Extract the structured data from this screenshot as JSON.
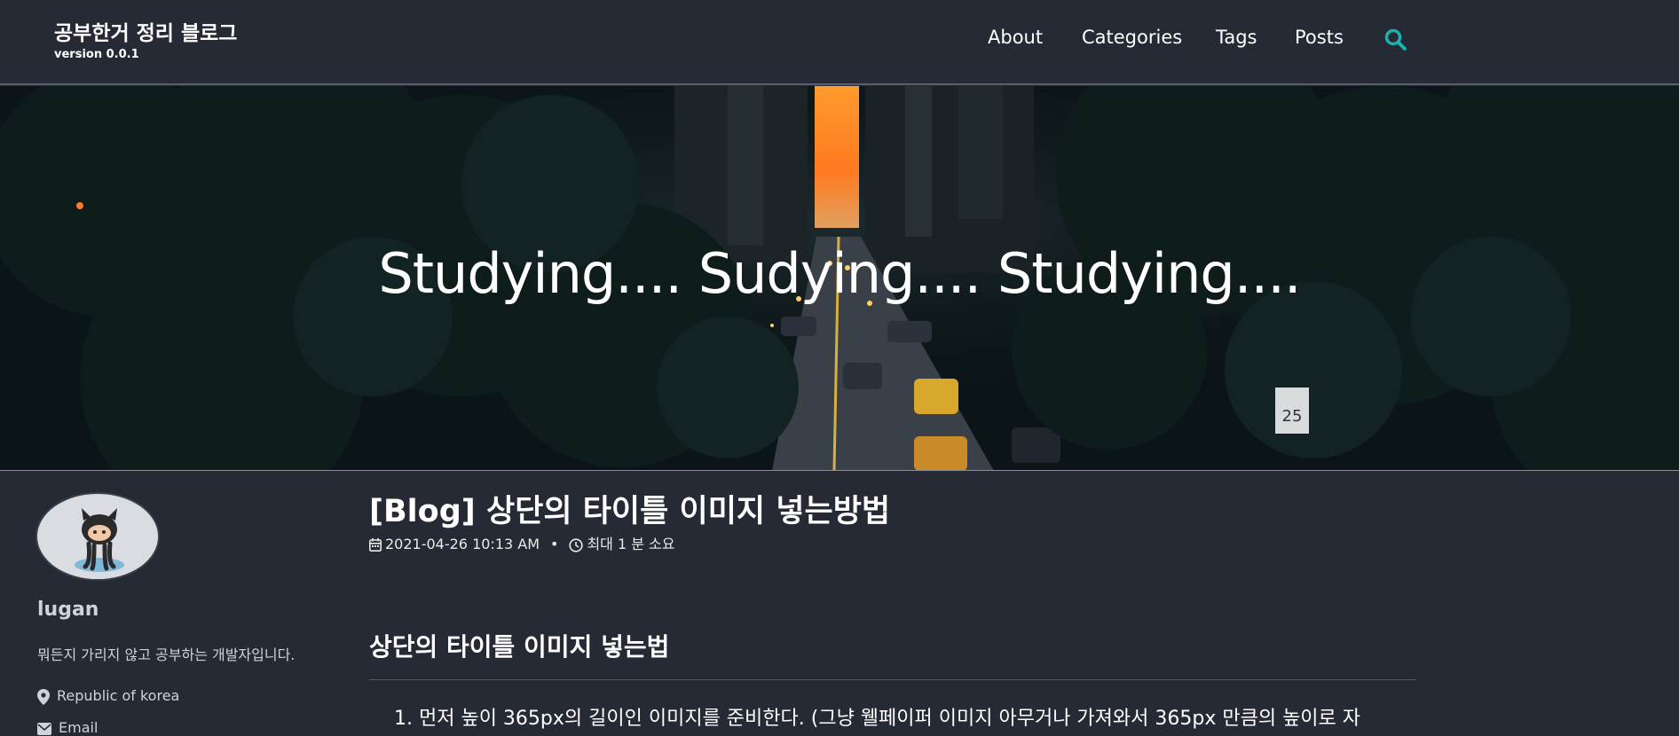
{
  "masthead": {
    "title": "공부한거 정리 블로그",
    "subtitle": "version 0.0.1",
    "nav": [
      {
        "label": "About"
      },
      {
        "label": "Categories"
      },
      {
        "label": "Tags"
      },
      {
        "label": "Posts"
      }
    ],
    "search_icon": "search-icon",
    "accent_color": "#1fb1b1"
  },
  "hero": {
    "title": "Studying.... Sudying.... Studying...."
  },
  "author": {
    "name": "lugan",
    "bio": "뭐든지 가리지 않고 공부하는 개발자입니다.",
    "location": "Republic of korea",
    "email_label": "Email"
  },
  "post": {
    "title": "[Blog] 상단의 타이틀 이미지 넣는방법",
    "date": "2021-04-26 10:13 AM",
    "read_time": "최대 1 분 소요",
    "section_heading": "상단의 타이틀 이미지 넣는법",
    "list": [
      "먼저 높이 365px의 길이인 이미지를 준비한다. (그냥 웰페이퍼 이미지 아무거나 가져와서 365px 만큼의 높이로 자"
    ]
  },
  "colors": {
    "background": "#252a34",
    "text": "#ffffff",
    "muted_text": "#cfd2d8"
  }
}
